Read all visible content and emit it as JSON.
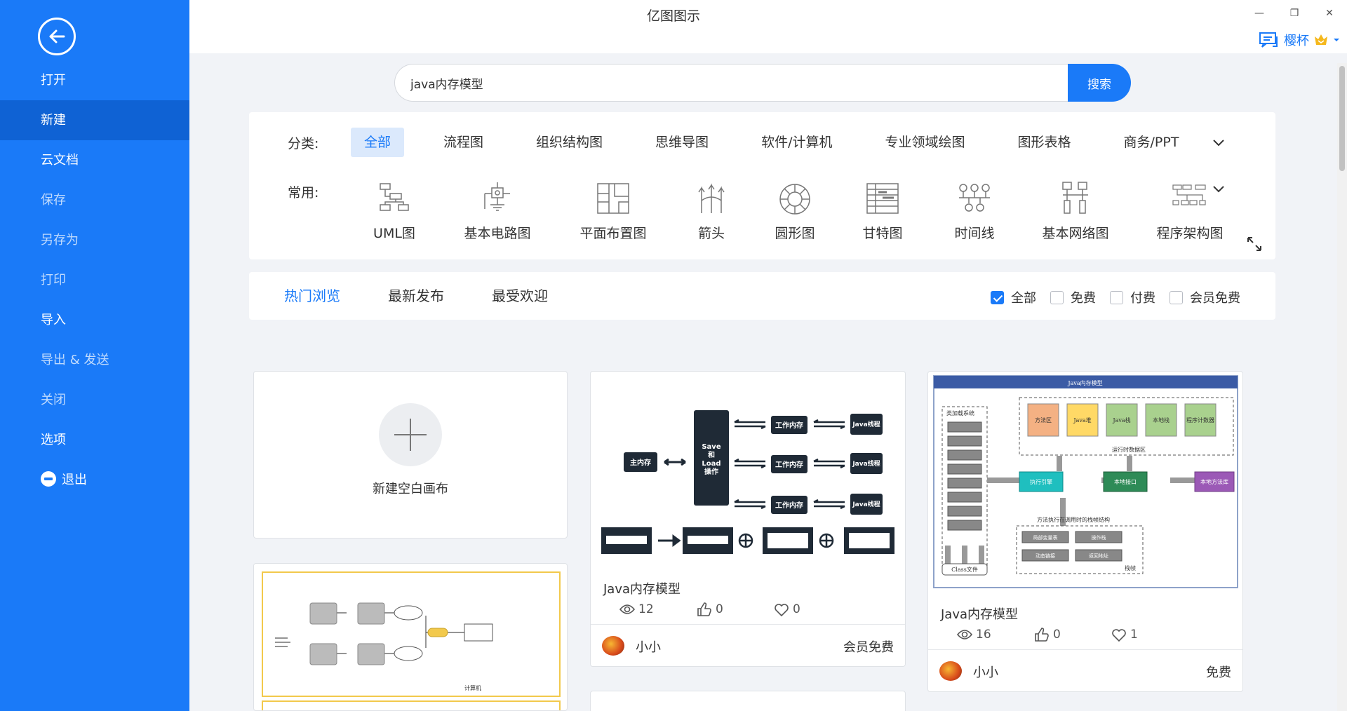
{
  "app": {
    "title": "亿图图示"
  },
  "window": {
    "minimize": "—",
    "restore": "❐",
    "close": "✕"
  },
  "user": {
    "name": "樱杯"
  },
  "sidebar": {
    "items": [
      {
        "label": "打开"
      },
      {
        "label": "新建"
      },
      {
        "label": "云文档"
      },
      {
        "label": "保存"
      },
      {
        "label": "另存为"
      },
      {
        "label": "打印"
      },
      {
        "label": "导入"
      },
      {
        "label": "导出 & 发送"
      },
      {
        "label": "关闭"
      },
      {
        "label": "选项"
      },
      {
        "label": "退出"
      }
    ]
  },
  "search": {
    "value": "java内存模型",
    "button": "搜索"
  },
  "categories": {
    "label": "分类:",
    "items": [
      "全部",
      "流程图",
      "组织结构图",
      "思维导图",
      "软件/计算机",
      "专业领域绘图",
      "图形表格",
      "商务/PPT"
    ]
  },
  "common": {
    "label": "常用:",
    "items": [
      "UML图",
      "基本电路图",
      "平面布置图",
      "箭头",
      "圆形图",
      "甘特图",
      "时间线",
      "基本网络图",
      "程序架构图"
    ]
  },
  "tabs": [
    "热门浏览",
    "最新发布",
    "最受欢迎"
  ],
  "filters": [
    {
      "label": "全部",
      "checked": true
    },
    {
      "label": "免费",
      "checked": false
    },
    {
      "label": "付费",
      "checked": false
    },
    {
      "label": "会员免费",
      "checked": false
    }
  ],
  "new_blank": {
    "label": "新建空白画布"
  },
  "cards": [
    {
      "title": "Java内存模型",
      "views": "12",
      "likes": "0",
      "favorites": "0",
      "author": "小小",
      "price": "会员免费"
    },
    {
      "title": "Java内存模型",
      "views": "16",
      "likes": "0",
      "favorites": "1",
      "author": "小小",
      "price": "免费"
    }
  ],
  "thumb1": {
    "main_memory": "主内存",
    "save_load": "Save\n和\nLoad\n操作",
    "work_memory": "工作内存",
    "java_thread": "Java线程"
  },
  "thumb2": {
    "title": "Java内存模型",
    "classloader": "类加载系统",
    "runtime": "运行时数据区",
    "exec": "执行引擎",
    "native_if": "本地接口",
    "native_lib": "本地方法库",
    "boxes": [
      "方法区",
      "Java堆",
      "Java栈",
      "本地栈",
      "程序计数器"
    ],
    "stack_label": "方法执行在调用时的栈帧结构",
    "frame": [
      "局部变量表",
      "操作栈",
      "动态链接",
      "返回地址"
    ],
    "class_file": "Class文件",
    "stack_frame": "栈帧"
  },
  "thumb3": {
    "label": "计算机"
  }
}
